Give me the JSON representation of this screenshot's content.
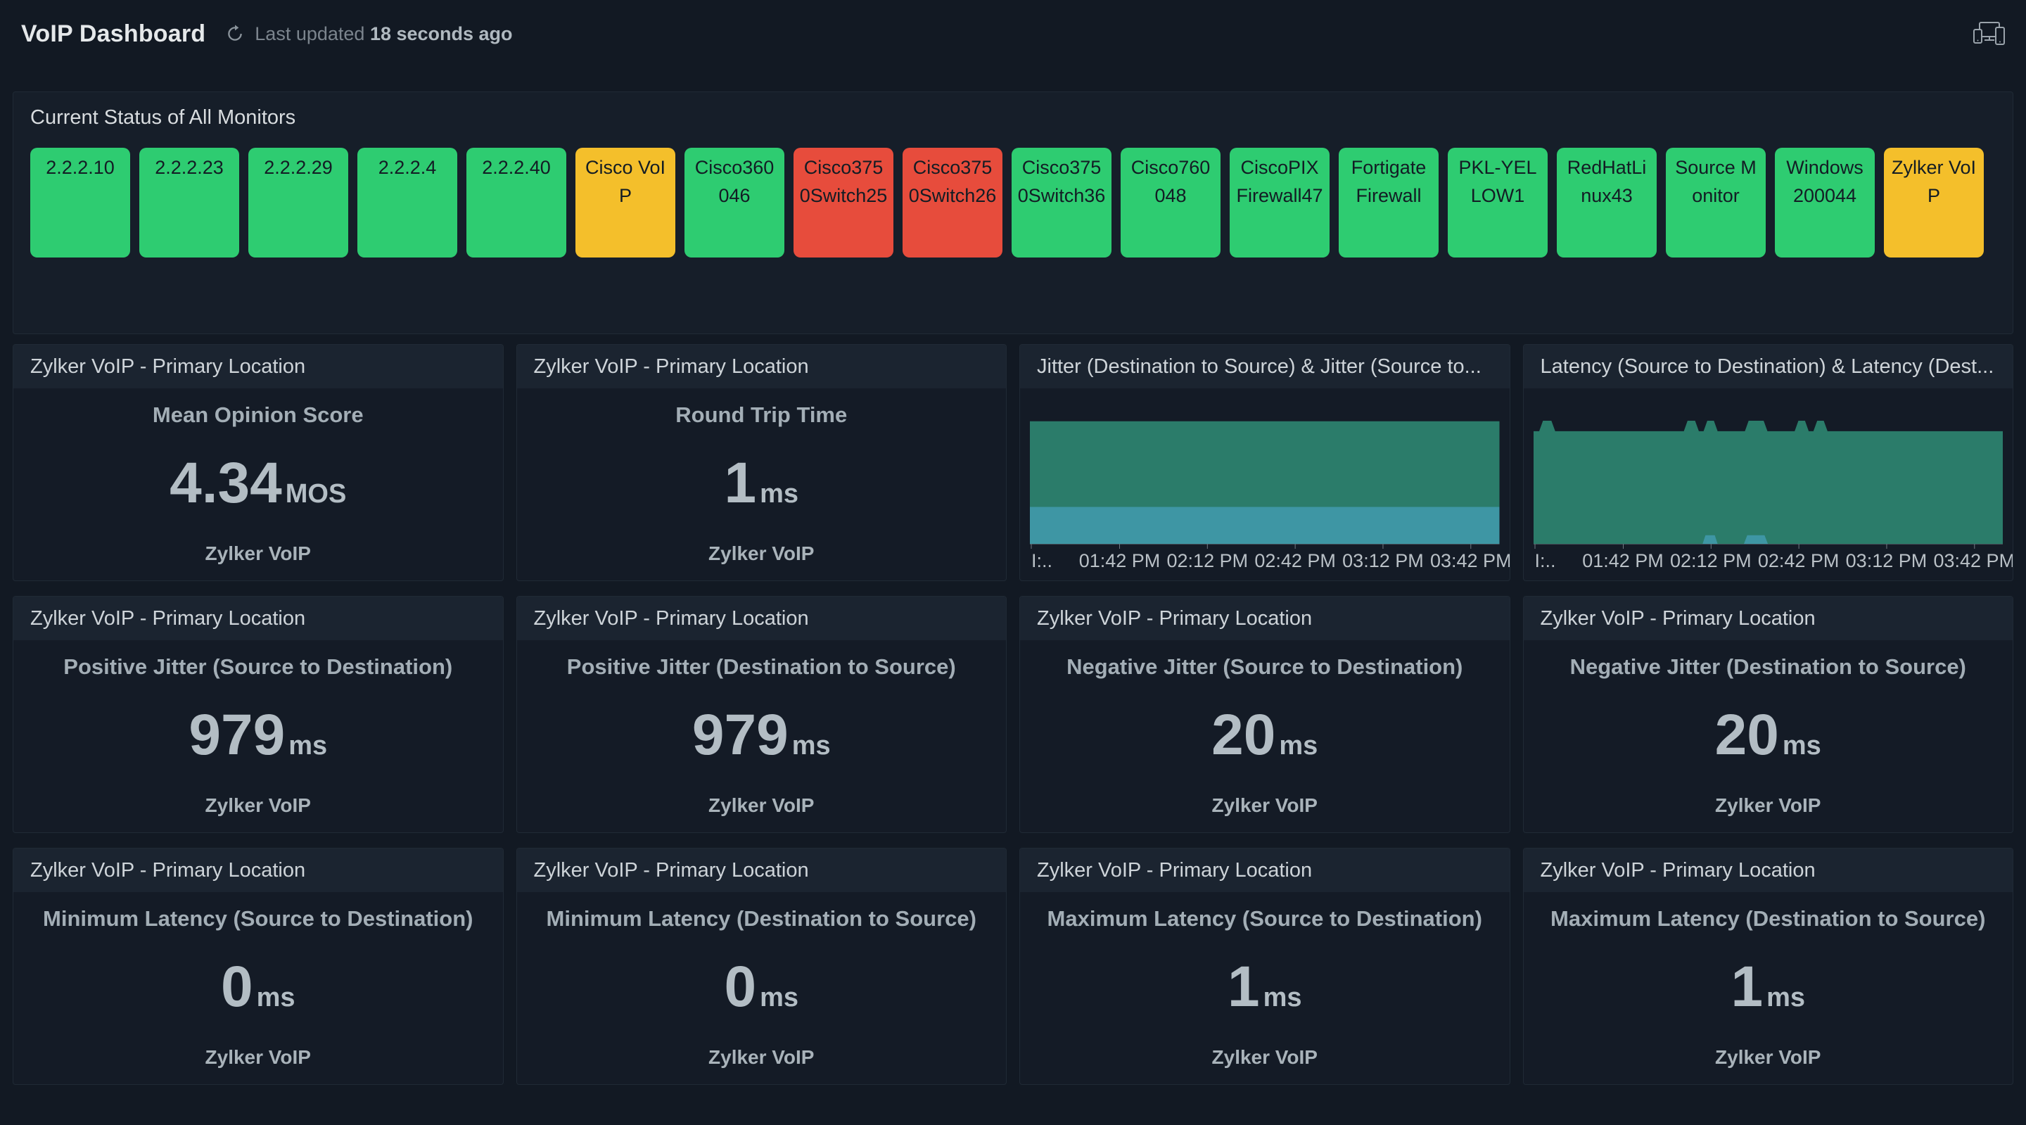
{
  "header": {
    "title": "VoIP Dashboard",
    "last_updated_prefix": "Last updated",
    "last_updated_value": "18 seconds ago"
  },
  "colors": {
    "status_up": "#2ecc71",
    "status_trouble": "#f4bf2b",
    "status_down": "#e74c3c",
    "chart_green": "#2b7c6a",
    "chart_cyan": "#3e96a4"
  },
  "status_panel": {
    "title": "Current Status of All Monitors",
    "monitors": [
      {
        "label": "2.2.2.10",
        "status": "up"
      },
      {
        "label": "2.2.2.23",
        "status": "up"
      },
      {
        "label": "2.2.2.29",
        "status": "up"
      },
      {
        "label": "2.2.2.4",
        "status": "up"
      },
      {
        "label": "2.2.2.40",
        "status": "up"
      },
      {
        "label": "Cisco VoIP",
        "status": "trouble"
      },
      {
        "label": "Cisco360046",
        "status": "up"
      },
      {
        "label": "Cisco3750Switch25",
        "status": "down"
      },
      {
        "label": "Cisco3750Switch26",
        "status": "down"
      },
      {
        "label": "Cisco3750Switch36",
        "status": "up"
      },
      {
        "label": "Cisco760048",
        "status": "up"
      },
      {
        "label": "CiscoPIXFirewall47",
        "status": "up"
      },
      {
        "label": "Fortigate Firewall",
        "status": "up"
      },
      {
        "label": "PKL-YELLOW1",
        "status": "up"
      },
      {
        "label": "RedHatLinux43",
        "status": "up"
      },
      {
        "label": "Source Monitor",
        "status": "up"
      },
      {
        "label": "Windows 200044",
        "status": "up"
      },
      {
        "label": "Zylker VoIP",
        "status": "trouble"
      }
    ]
  },
  "metric_cards": [
    {
      "header": "Zylker VoIP - Primary Location",
      "title": "Mean Opinion Score",
      "value": "4.34",
      "unit": "MOS",
      "footer": "Zylker VoIP"
    },
    {
      "header": "Zylker VoIP - Primary Location",
      "title": "Round Trip Time",
      "value": "1",
      "unit": "ms",
      "footer": "Zylker VoIP"
    },
    {
      "header": "Zylker VoIP - Primary Location",
      "title": "Positive Jitter (Source to Destination)",
      "value": "979",
      "unit": "ms",
      "footer": "Zylker VoIP"
    },
    {
      "header": "Zylker VoIP - Primary Location",
      "title": "Positive Jitter (Destination to Source)",
      "value": "979",
      "unit": "ms",
      "footer": "Zylker VoIP"
    },
    {
      "header": "Zylker VoIP - Primary Location",
      "title": "Negative Jitter (Source to Destination)",
      "value": "20",
      "unit": "ms",
      "footer": "Zylker VoIP"
    },
    {
      "header": "Zylker VoIP - Primary Location",
      "title": "Negative Jitter (Destination to Source)",
      "value": "20",
      "unit": "ms",
      "footer": "Zylker VoIP"
    },
    {
      "header": "Zylker VoIP - Primary Location",
      "title": "Minimum Latency (Source to Destination)",
      "value": "0",
      "unit": "ms",
      "footer": "Zylker VoIP"
    },
    {
      "header": "Zylker VoIP - Primary Location",
      "title": "Minimum Latency (Destination to Source)",
      "value": "0",
      "unit": "ms",
      "footer": "Zylker VoIP"
    },
    {
      "header": "Zylker VoIP - Primary Location",
      "title": "Maximum Latency (Source to Destination)",
      "value": "1",
      "unit": "ms",
      "footer": "Zylker VoIP"
    },
    {
      "header": "Zylker VoIP - Primary Location",
      "title": "Maximum Latency (Destination to Source)",
      "value": "1",
      "unit": "ms",
      "footer": "Zylker VoIP"
    }
  ],
  "charts": [
    {
      "type": "area",
      "header": "Jitter (Destination to Source) & Jitter (Source to...",
      "x_labels": [
        "I:..",
        "01:42 PM",
        "02:12 PM",
        "02:42 PM",
        "03:12 PM",
        "03:42 PM"
      ],
      "tick_positions": [
        0.003,
        0.191,
        0.378,
        0.565,
        0.752,
        0.939
      ],
      "areas": [
        {
          "name": "Jitter (Destination to Source)",
          "color": "#2b7c6a",
          "points_norm": [
            [
              0,
              0.004
            ],
            [
              1,
              0.004
            ]
          ]
        },
        {
          "name": "Jitter (Source to...",
          "color": "#3e96a4",
          "points_norm": [
            [
              0,
              0.7
            ],
            [
              1,
              0.7
            ]
          ]
        }
      ]
    },
    {
      "type": "area",
      "header": "Latency (Source to Destination) & Latency (Dest...",
      "x_labels": [
        "I:..",
        "01:42 PM",
        "02:12 PM",
        "02:42 PM",
        "03:12 PM",
        "03:42 PM"
      ],
      "tick_positions": [
        0.003,
        0.191,
        0.378,
        0.565,
        0.752,
        0.939
      ],
      "areas": [
        {
          "name": "Latency (Source to Destination)",
          "color": "#2b7c6a",
          "points_norm": [
            [
              0,
              0.085
            ],
            [
              0.012,
              0.085
            ],
            [
              0.02,
              0
            ],
            [
              0.038,
              0
            ],
            [
              0.046,
              0.085
            ],
            [
              0.32,
              0.085
            ],
            [
              0.328,
              0
            ],
            [
              0.344,
              0
            ],
            [
              0.352,
              0.085
            ],
            [
              0.362,
              0.085
            ],
            [
              0.37,
              0
            ],
            [
              0.384,
              0
            ],
            [
              0.392,
              0.085
            ],
            [
              0.45,
              0.085
            ],
            [
              0.458,
              0
            ],
            [
              0.49,
              0
            ],
            [
              0.498,
              0.085
            ],
            [
              0.556,
              0.085
            ],
            [
              0.564,
              0
            ],
            [
              0.578,
              0
            ],
            [
              0.586,
              0.085
            ],
            [
              0.596,
              0.085
            ],
            [
              0.604,
              0
            ],
            [
              0.618,
              0
            ],
            [
              0.626,
              0.085
            ],
            [
              1,
              0.085
            ]
          ]
        },
        {
          "name": "Latency (Dest...",
          "color": "#3e96a4",
          "points_norm": [
            [
              0,
              1
            ],
            [
              0.36,
              1
            ],
            [
              0.366,
              0.93
            ],
            [
              0.386,
              0.93
            ],
            [
              0.392,
              1
            ],
            [
              0.448,
              1
            ],
            [
              0.455,
              0.93
            ],
            [
              0.492,
              0.93
            ],
            [
              0.499,
              1
            ],
            [
              1,
              1
            ]
          ]
        }
      ]
    }
  ]
}
